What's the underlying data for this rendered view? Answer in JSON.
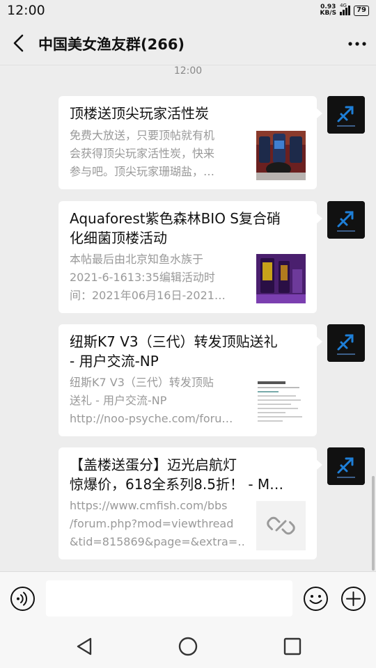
{
  "status_bar": {
    "time": "12:00",
    "net_speed_value": "0.93",
    "net_speed_unit": "KB/S",
    "network": "4G",
    "battery": "79"
  },
  "header": {
    "title": "中国美女渔友群(266)"
  },
  "chat": {
    "timestamp": "12:00",
    "messages": [
      {
        "title": "顶楼送顶尖玩家活性炭",
        "desc": [
          "免费大放送，只要顶帖就有机",
          "会获得顶尖玩家活性炭，快来",
          "参与吧。顶尖玩家珊瑚盐，…"
        ]
      },
      {
        "title": [
          "Aquaforest紫色森林BIO S复合硝",
          "化细菌顶楼活动"
        ],
        "desc": [
          "本帖最后由北京知鱼水族于",
          "2021-6-1613:35编辑活动时",
          "间：2021年06月16日-2021…"
        ]
      },
      {
        "title": [
          "纽斯K7 V3（三代）转发顶贴送礼",
          "- 用户交流-NP"
        ],
        "desc": [
          "纽斯K7 V3（三代）转发顶贴",
          "送礼 - 用户交流-NP",
          "http://noo-psyche.com/foru…"
        ]
      },
      {
        "title": [
          "【盖楼送蛋分】迈光启航灯",
          "惊爆价，618全系列8.5折！ - M…"
        ],
        "desc": [
          "https://www.cmfish.com/bbs",
          "/forum.php?mod=viewthread",
          "&tid=815869&page=&extra=…"
        ]
      }
    ]
  },
  "colors": {
    "background": "#ededed",
    "bubble": "#ffffff",
    "title_text": "#111111",
    "desc_text": "#999999",
    "avatar_bg": "#111111",
    "avatar_accent": "#1e7fd8"
  },
  "icons": {
    "back": "chevron-left-icon",
    "more": "more-dots-icon",
    "voice": "voice-icon",
    "emoji": "emoji-icon",
    "plus": "plus-icon",
    "link": "link-icon",
    "nav_back": "triangle-back-icon",
    "nav_home": "circle-home-icon",
    "nav_recent": "square-recent-icon"
  }
}
